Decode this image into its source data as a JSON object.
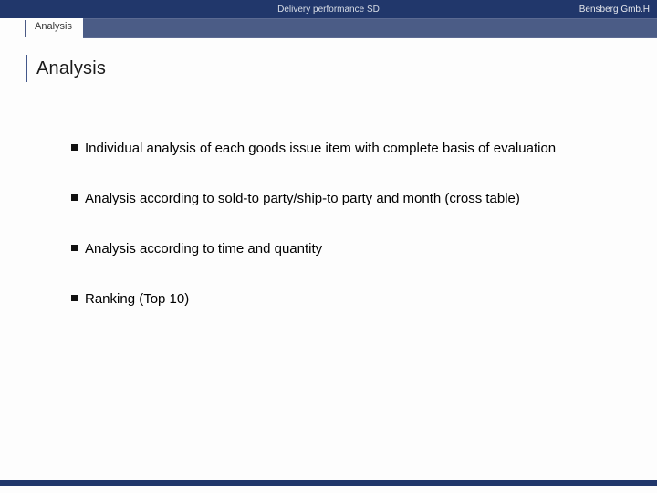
{
  "header": {
    "title": "Delivery performance SD",
    "brand": "Bensberg Gmb.H"
  },
  "tab": {
    "label": "Analysis"
  },
  "heading": "Analysis",
  "bullets": [
    "Individual analysis of each goods issue item with complete basis of evaluation",
    "Analysis according to sold-to party/ship-to party and month (cross table)",
    "Analysis according to time and quantity",
    "Ranking (Top 10)"
  ]
}
